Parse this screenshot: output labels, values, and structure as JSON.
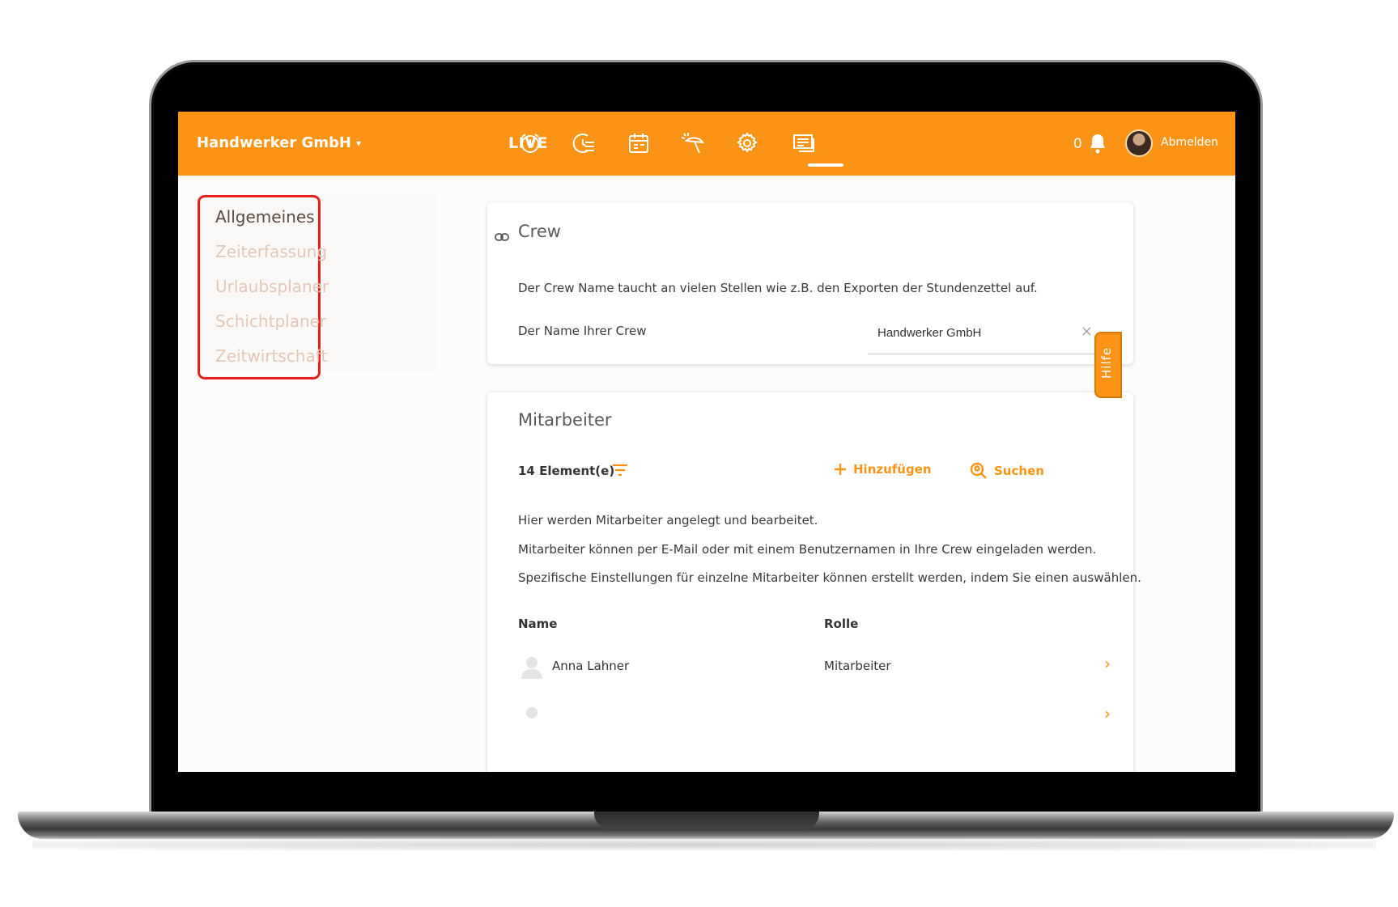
{
  "topbar": {
    "brand": "Handwerker GmbH",
    "brand_caret": "▾",
    "live_label": "LIVE",
    "nav_icons": [
      "alarm-clock-icon",
      "timesheet-list-icon",
      "calendar-icon",
      "vacation-umbrella-icon",
      "settings-gear-icon",
      "messages-icon"
    ],
    "active_nav": "settings-gear-icon",
    "notification_count": "0",
    "logout_label": "Abmelden",
    "accent_color": "#fb9416"
  },
  "sidebar": {
    "items": [
      {
        "label": "Allgemeines",
        "active": true
      },
      {
        "label": "Zeiterfassung",
        "active": false
      },
      {
        "label": "Urlaubsplaner",
        "active": false
      },
      {
        "label": "Schichtplaner",
        "active": false
      },
      {
        "label": "Zeitwirtschaft",
        "active": false
      }
    ],
    "highlight_color": "#e8201b"
  },
  "crew": {
    "title": "Crew",
    "description": "Der Crew Name taucht an vielen Stellen wie z.B. den Exporten der Stundenzettel auf.",
    "name_label": "Der Name Ihrer Crew",
    "name_value": "Handwerker GmbH",
    "clear_symbol": "×"
  },
  "staff": {
    "title": "Mitarbeiter",
    "count_label": "14 Element(e)",
    "add_label": "Hinzufügen",
    "search_label": "Suchen",
    "info_lines": [
      "Hier werden Mitarbeiter angelegt und bearbeitet.",
      "Mitarbeiter können per E-Mail oder mit einem Benutzernamen in Ihre Crew eingeladen werden.",
      "Spezifische Einstellungen für einzelne Mitarbeiter können erstellt werden, indem Sie einen auswählen."
    ],
    "columns": [
      "Name",
      "Rolle"
    ],
    "rows": [
      {
        "name": "Anna Lahner",
        "role": "Mitarbeiter"
      }
    ]
  },
  "help": {
    "label": "Hilfe"
  }
}
